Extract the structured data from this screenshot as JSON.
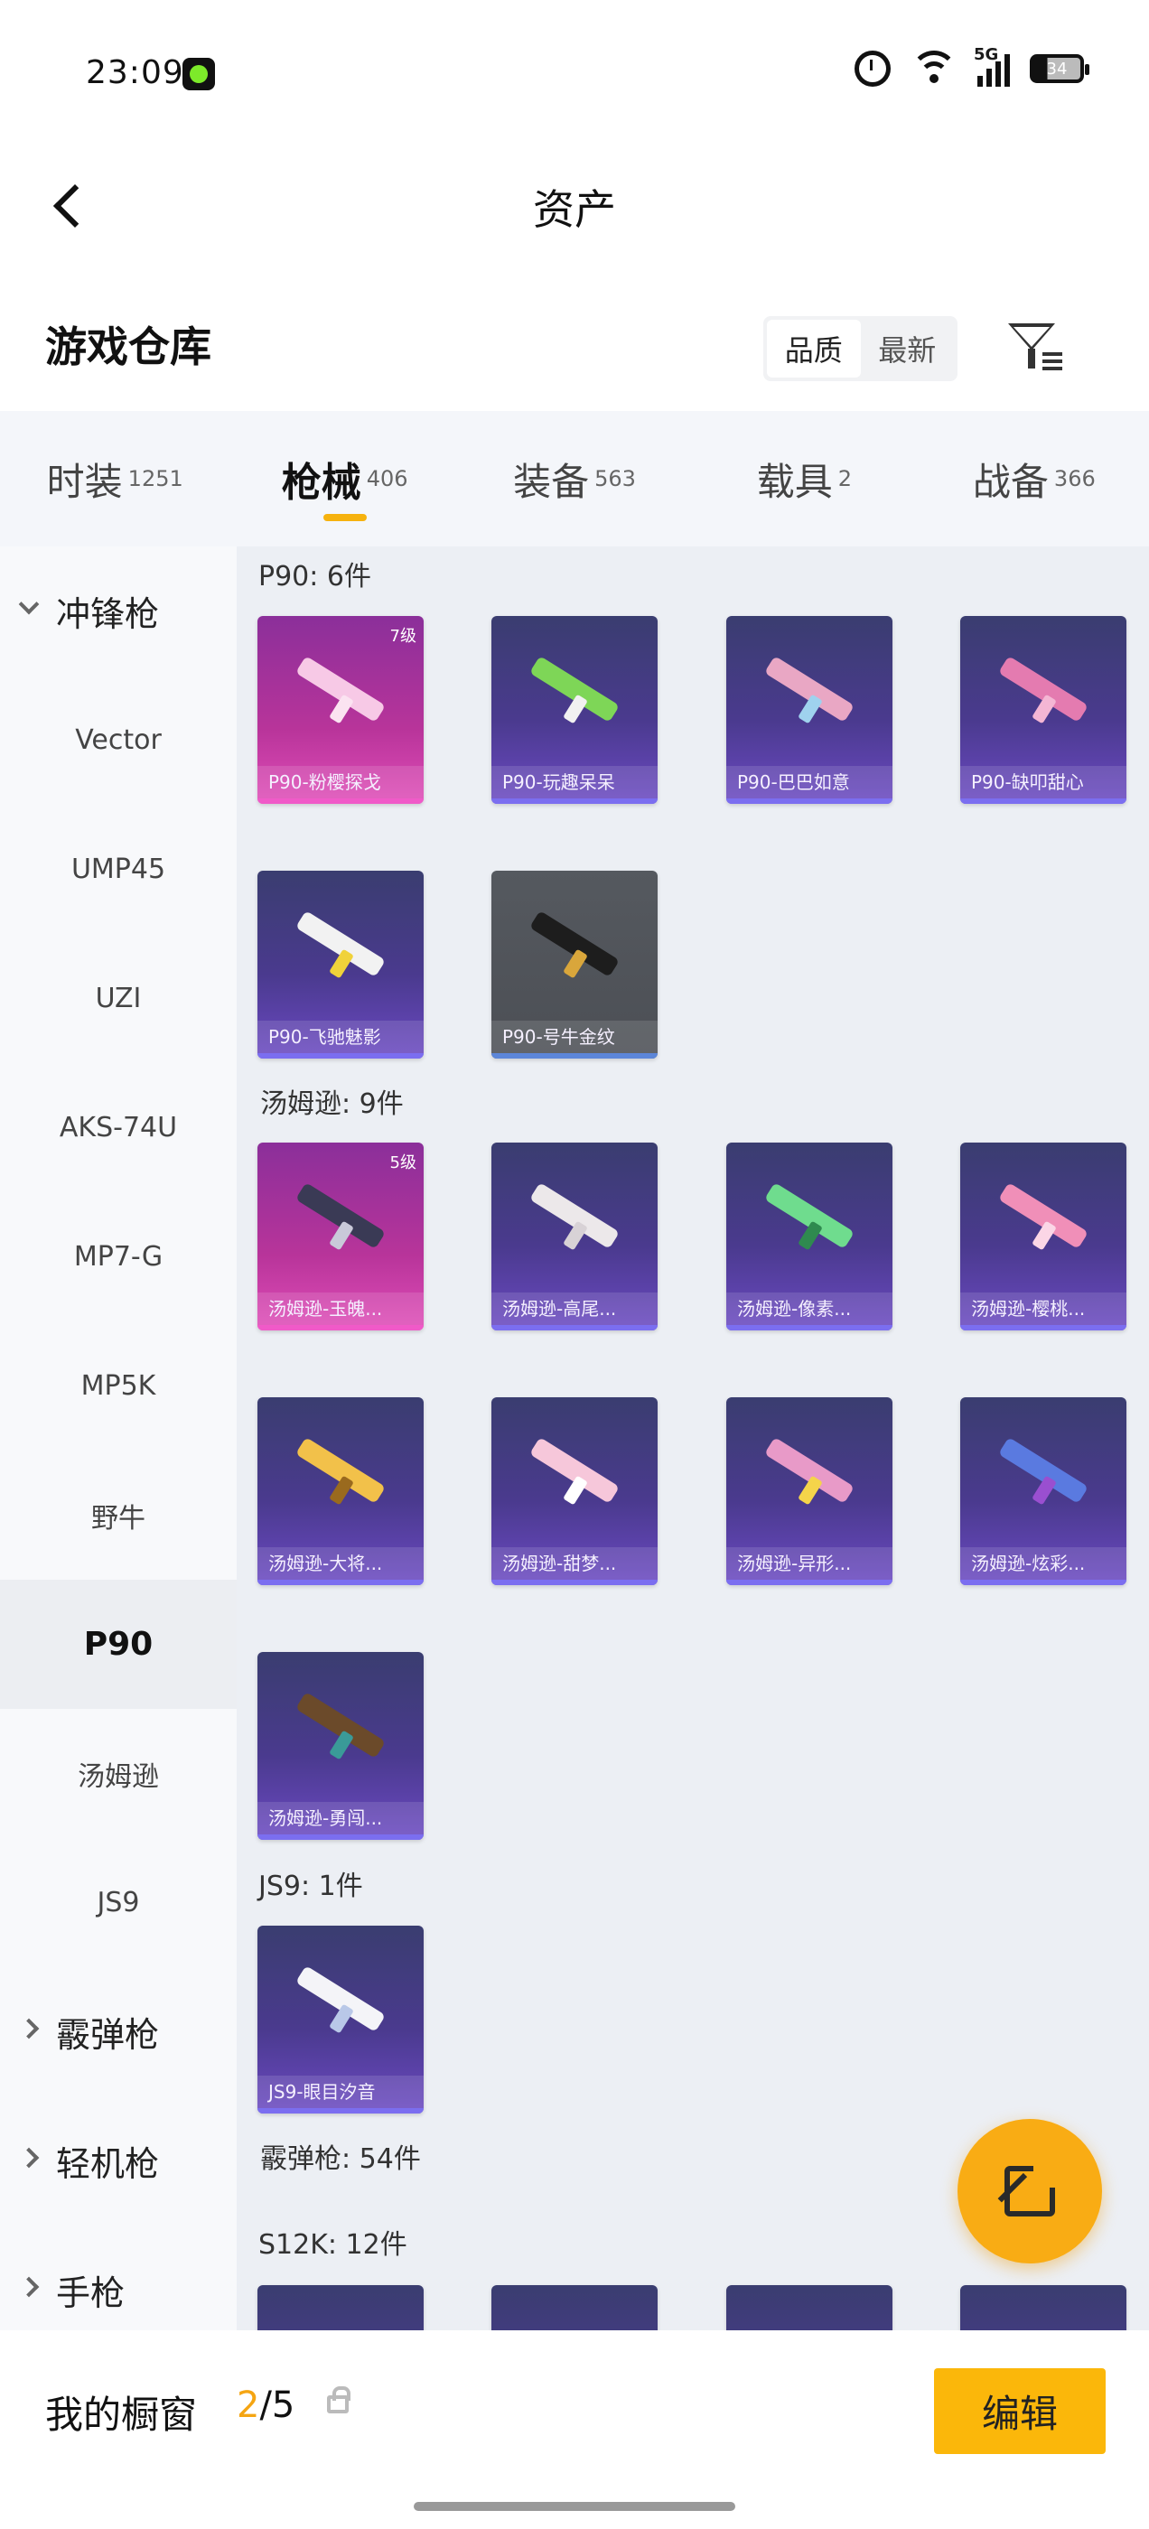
{
  "status_bar": {
    "time": "23:09",
    "network": "5G",
    "battery": "34"
  },
  "nav": {
    "title": "资产"
  },
  "section": {
    "title": "游戏仓库",
    "sort_options": [
      "品质",
      "最新"
    ],
    "active_sort": 0
  },
  "tabs": [
    {
      "label": "时装",
      "count": "1251"
    },
    {
      "label": "枪械",
      "count": "406"
    },
    {
      "label": "装备",
      "count": "563"
    },
    {
      "label": "载具",
      "count": "2"
    },
    {
      "label": "战备",
      "count": "366"
    }
  ],
  "sidebar": {
    "group_smg": "冲锋枪",
    "items": [
      "Vector",
      "UMP45",
      "UZI",
      "AKS-74U",
      "MP7-G",
      "MP5K",
      "野牛",
      "P90",
      "汤姆逊",
      "JS9"
    ],
    "active_item": "P90",
    "group_shotgun": "霰弹枪",
    "group_lmg": "轻机枪",
    "group_pistol": "手枪"
  },
  "groups": {
    "p90": {
      "header": "P90: 6件",
      "items": [
        {
          "name": "P90-粉樱探戈",
          "level": "7级"
        },
        {
          "name": "P90-玩趣呆呆"
        },
        {
          "name": "P90-巴巴如意"
        },
        {
          "name": "P90-缺叩甜心"
        },
        {
          "name": "P90-飞驰魅影"
        },
        {
          "name": "P90-号牛金纹"
        }
      ]
    },
    "thompson": {
      "header": "汤姆逊: 9件",
      "items": [
        {
          "name": "汤姆逊-玉魄...",
          "level": "5级"
        },
        {
          "name": "汤姆逊-高尾..."
        },
        {
          "name": "汤姆逊-像素..."
        },
        {
          "name": "汤姆逊-樱桃..."
        },
        {
          "name": "汤姆逊-大将..."
        },
        {
          "name": "汤姆逊-甜梦..."
        },
        {
          "name": "汤姆逊-异形..."
        },
        {
          "name": "汤姆逊-炫彩..."
        },
        {
          "name": "汤姆逊-勇闯..."
        }
      ]
    },
    "js9": {
      "header": "JS9: 1件",
      "items": [
        {
          "name": "JS9-眼目汐音"
        }
      ]
    },
    "shotgun_header": "霰弹枪: 54件",
    "s12k_header": "S12K: 12件"
  },
  "bottom": {
    "showcase_label": "我的橱窗",
    "showcase_current": "2",
    "showcase_total": "/5",
    "edit_label": "编辑"
  },
  "colors": {
    "accent": "#f9ac14",
    "tab_indicator": "#f6b20e"
  }
}
